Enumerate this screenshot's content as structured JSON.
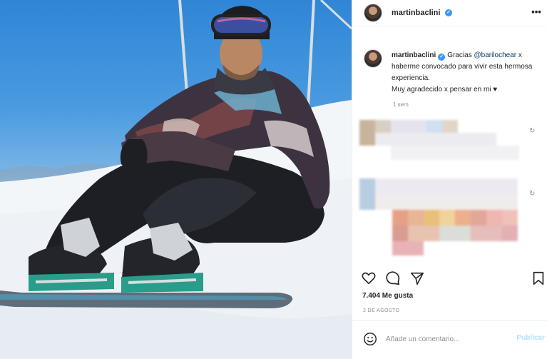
{
  "post": {
    "username": "martinbaclini",
    "verified_mark": "✓",
    "more_icon": "•••",
    "caption": {
      "username": "martinbaclini",
      "text_before": "Gracias ",
      "mention": "@barilochear",
      "text_after": " x haberme convocado para vivir esta hermosa experiencia.",
      "line2": "Muy agradecido x pensar en mi ♥"
    },
    "time_ago": "1 sem",
    "likes": "7.404 Me gusta",
    "date": "2 DE AGOSTO",
    "comment_placeholder": "Añade un comentario...",
    "publish_label": "Publicar"
  },
  "colors": {
    "link": "#00376b",
    "verified": "#3897f0",
    "publish_disabled": "#b2dffc",
    "muted": "#8e8e8e"
  }
}
